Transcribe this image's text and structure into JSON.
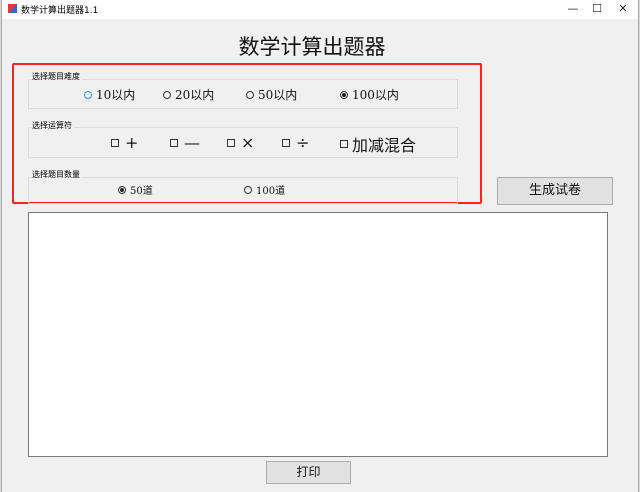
{
  "window": {
    "title": "数学计算出题器1.1",
    "minimize": "—",
    "maximize": "☐",
    "close": "✕"
  },
  "heading": "数学计算出题器",
  "difficulty": {
    "label": "选择题目难度",
    "options": [
      "10以内",
      "20以内",
      "50以内",
      "100以内"
    ],
    "selected": "100以内"
  },
  "operators": {
    "label": "选择运算符",
    "options": [
      "+",
      "—",
      "×",
      "÷",
      "加减混合"
    ]
  },
  "count": {
    "label": "选择题目数量",
    "options": [
      "50道",
      "100道"
    ],
    "selected": "50道"
  },
  "buttons": {
    "generate": "生成试卷",
    "print": "打印"
  },
  "output": ""
}
